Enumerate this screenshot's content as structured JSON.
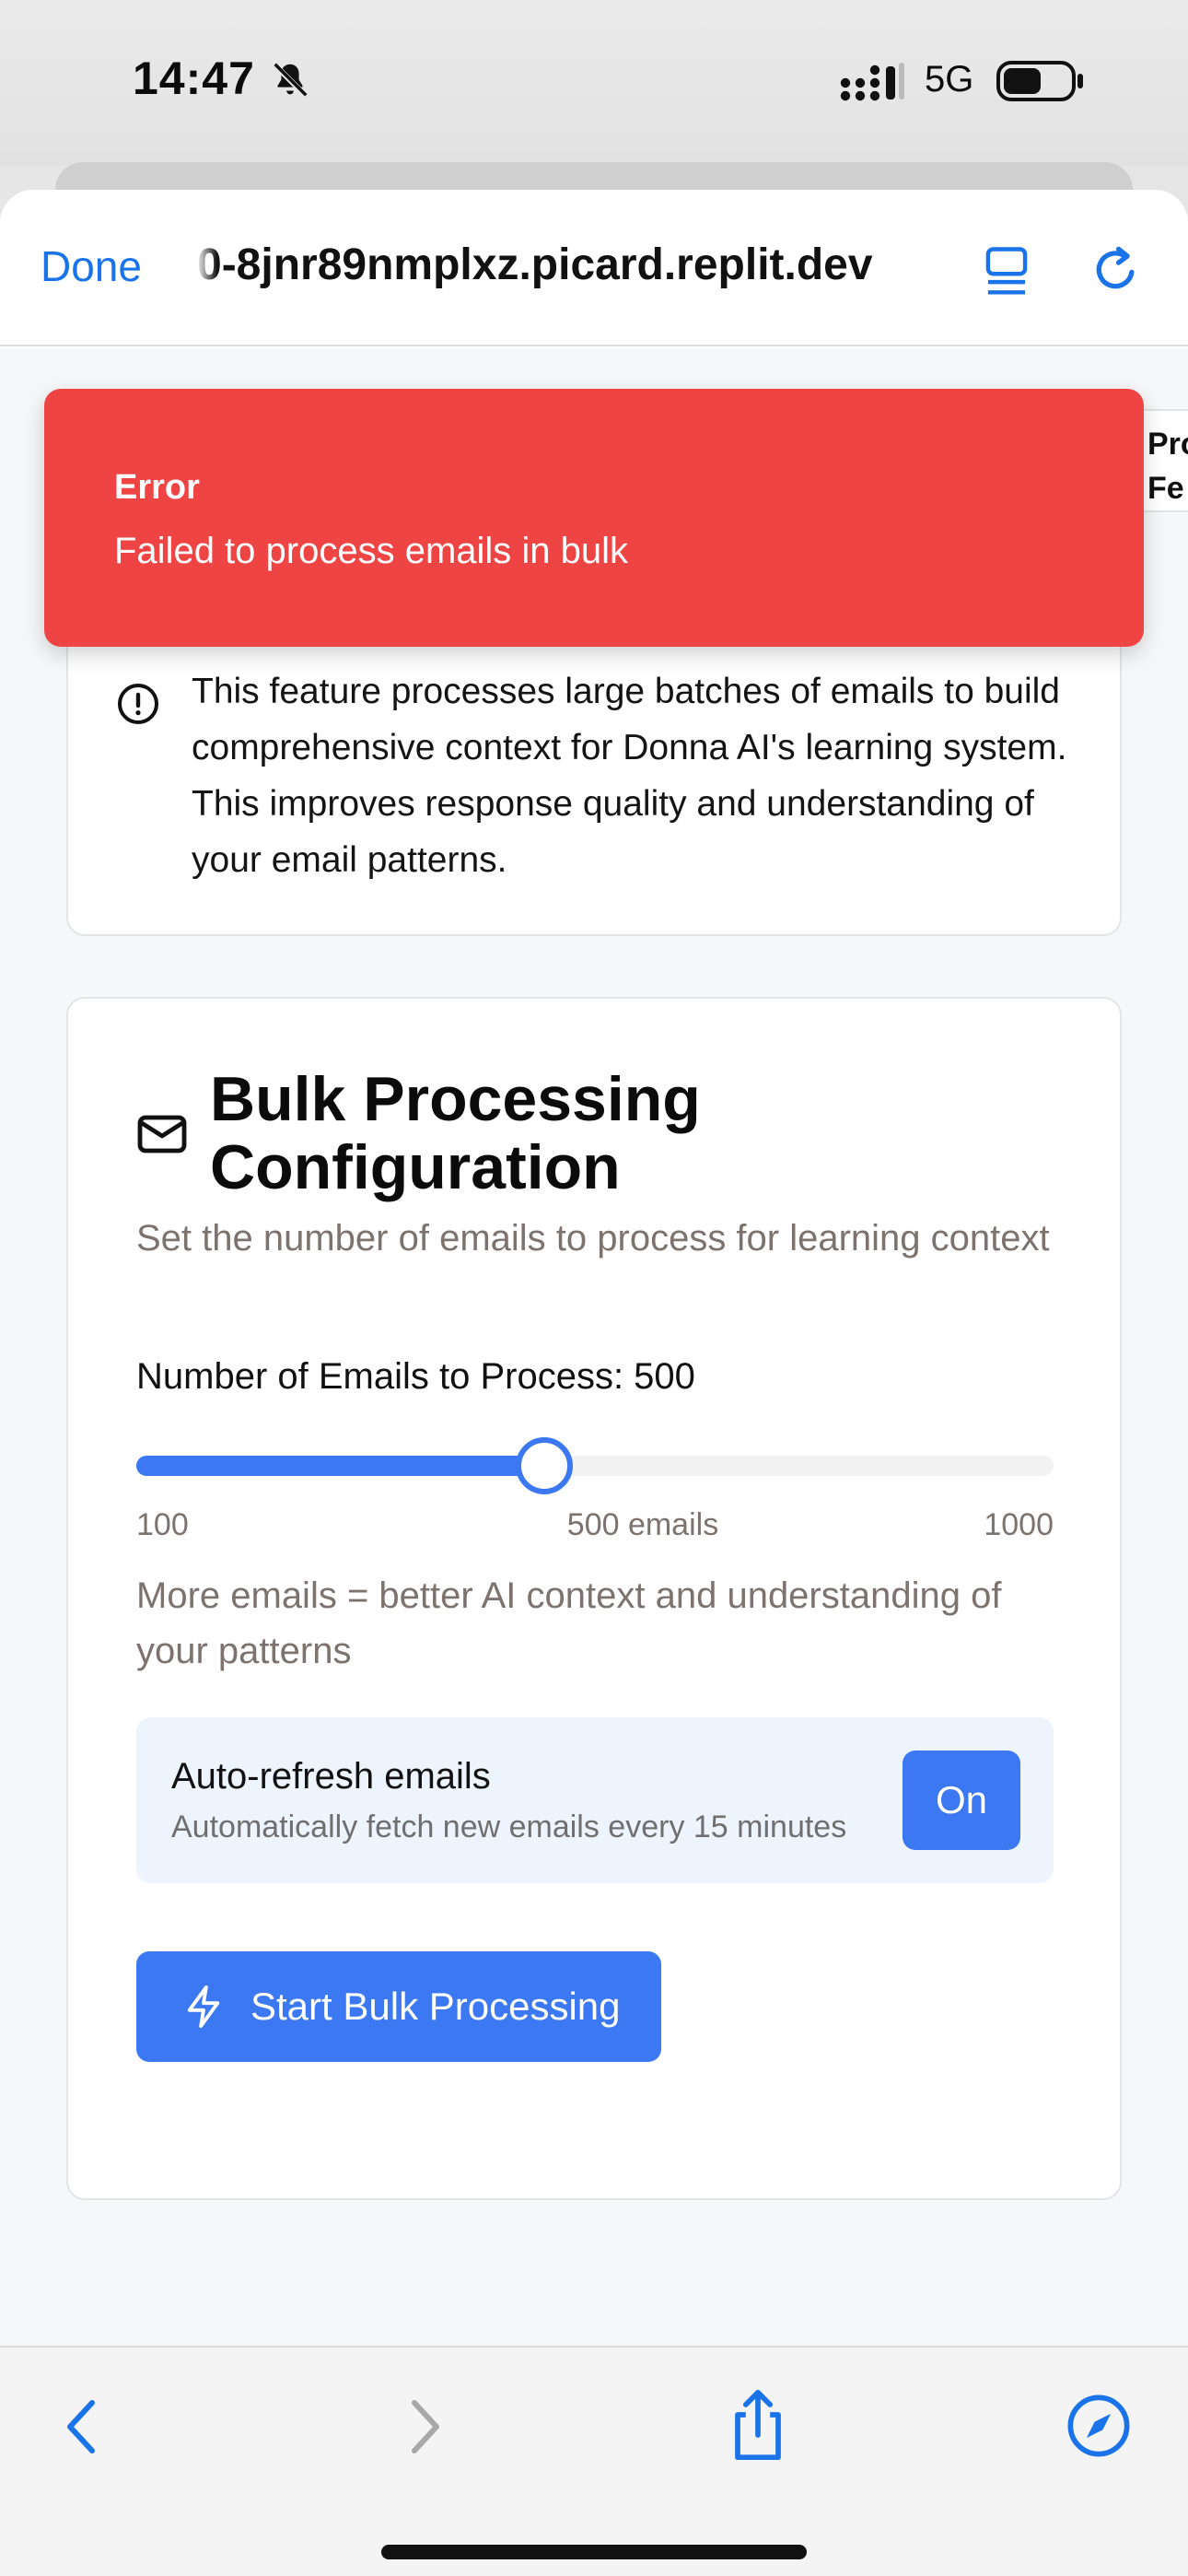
{
  "status_bar": {
    "time": "14:47",
    "network": "5G",
    "icons": [
      "bell-slash-icon",
      "signal-icon",
      "battery-icon"
    ]
  },
  "browser": {
    "done_label": "Done",
    "url": "0-8jnr89nmplxz.picard.replit.dev",
    "icons": [
      "reader-icon",
      "reload-icon"
    ]
  },
  "toast": {
    "title": "Error",
    "message": "Failed to process emails in bulk",
    "color": "#ef4444"
  },
  "side_card": {
    "line1": "Pro",
    "line2": "Fe"
  },
  "info_card": {
    "icon": "alert-circle-icon",
    "text": "This feature processes large batches of emails to build comprehensive context for Donna AI's learning system. This improves response quality and understanding of your email patterns."
  },
  "config": {
    "icon": "mail-icon",
    "title": "Bulk Processing Configuration",
    "subtitle": "Set the number of emails to process for learning context",
    "slider": {
      "label": "Number of Emails to Process: 500",
      "min": 100,
      "max": 1000,
      "value": 500,
      "min_label": "100",
      "mid_label": "500 emails",
      "max_label": "1000"
    },
    "hint": "More emails = better AI context and understanding of your patterns",
    "auto_refresh": {
      "title": "Auto-refresh emails",
      "description": "Automatically fetch new emails every 15 minutes",
      "toggle_label": "On"
    },
    "start_button": {
      "icon": "bolt-icon",
      "label": "Start Bulk Processing"
    },
    "accent_color": "#3b78f2"
  },
  "toolbar": {
    "icons": [
      "back-icon",
      "forward-icon",
      "share-icon",
      "compass-icon"
    ]
  }
}
